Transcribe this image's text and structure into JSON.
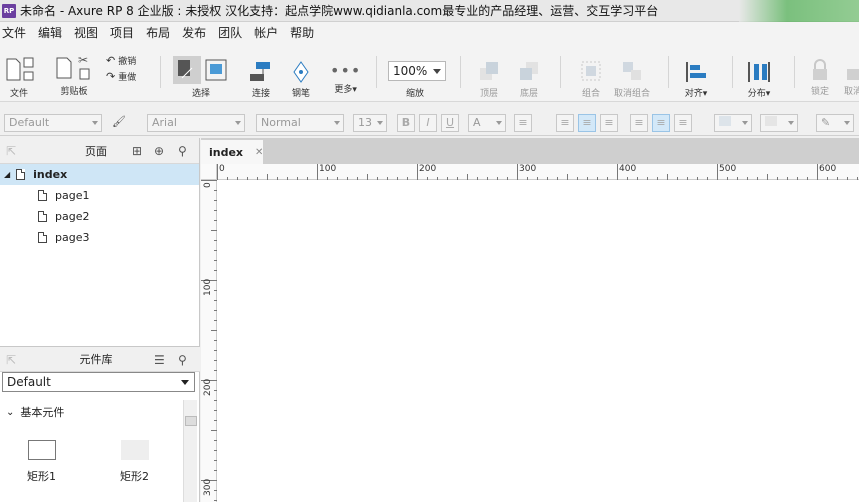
{
  "window": {
    "logo": "RP",
    "title": "未命名 - Axure RP 8 企业版 : 未授权 汉化支持：起点学院www.qidianla.com最专业的产品经理、运营、交互学习平台"
  },
  "menu": [
    "文件",
    "编辑",
    "视图",
    "项目",
    "布局",
    "发布",
    "团队",
    "帐户",
    "帮助"
  ],
  "toolbar": {
    "file": "文件",
    "clipboard": "剪贴板",
    "undo": "撤销",
    "redo": "重做",
    "select": "选择",
    "connect": "连接",
    "pen": "钢笔",
    "more": "更多▾",
    "zoom_value": "100%",
    "zoom_label": "缩放",
    "top": "顶层",
    "bottom": "底层",
    "group": "组合",
    "ungroup": "取消组合",
    "align": "对齐▾",
    "distribute": "分布▾",
    "lock": "锁定",
    "unlock": "取消"
  },
  "format": {
    "style": "Default",
    "font": "Arial",
    "weight": "Normal",
    "size": "13",
    "bold": "B",
    "italic": "I",
    "underline": "U",
    "fontcolor": "A"
  },
  "pages_panel": {
    "title": "页面",
    "root": "index",
    "children": [
      "page1",
      "page2",
      "page3"
    ]
  },
  "library_panel": {
    "title": "元件库",
    "selected_library": "Default",
    "section": "基本元件",
    "widgets": [
      "矩形1",
      "矩形2"
    ]
  },
  "canvas": {
    "tab": "index",
    "tab_close": "✕",
    "h_ticks": [
      "0",
      "100",
      "200",
      "300",
      "400",
      "500",
      "600"
    ],
    "v_ticks": [
      "0",
      "100",
      "200",
      "300"
    ]
  }
}
